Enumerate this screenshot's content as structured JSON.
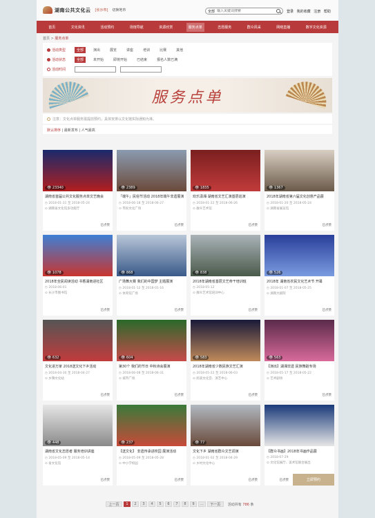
{
  "header": {
    "site_name": "湖南公共文化云",
    "region": "[长沙市]",
    "region_switch": "切换地市",
    "search_scope": "全部",
    "search_placeholder": "输入关键词搜索",
    "user_links": [
      "登录",
      "我的收藏",
      "注册",
      "帮助"
    ]
  },
  "nav": {
    "items": [
      "首页",
      "文化资讯",
      "活动预约",
      "场馆导航",
      "资源欣赏",
      "服务点单",
      "志愿服务",
      "群众风采",
      "网络直播",
      "数字文化资源"
    ],
    "active_index": 5
  },
  "breadcrumb": {
    "home": "首页",
    "sep": ">",
    "current": "服务点单"
  },
  "filters": {
    "type": {
      "label": "活动类型",
      "options": [
        "全部",
        "演出",
        "展览",
        "讲座",
        "培训",
        "比赛",
        "其他"
      ],
      "active_index": 0
    },
    "status": {
      "label": "活动状态",
      "options": [
        "全部",
        "未开始",
        "即将开始",
        "已结束",
        "报名人数已满"
      ],
      "active_index": 0
    },
    "time": {
      "label": "活动时间"
    }
  },
  "banner": {
    "title": "服务点单"
  },
  "notice": {
    "text": "注意：文化点单服务需提前预约，具体安排以文化馆实际通知为准。"
  },
  "sort": {
    "items": [
      "默认排序",
      "最新发布",
      "人气最高"
    ],
    "active_index": 0
  },
  "cards": [
    {
      "views": "23340",
      "title": "湖南省首届公共文化服务点单文艺晚会",
      "date": "2018-01-31 至 2018-05-24",
      "place": "湖南省文化馆多功能厅",
      "comment": "已点赞"
    },
    {
      "views": "2389",
      "title": "「端午」民俗节活动 2018年端午非遗展演",
      "date": "2018-06-18 至 2018-06-27",
      "place": "市民文化广场",
      "comment": "已点赞"
    },
    {
      "views": "1835",
      "title": "欢乐潇湘·湖南省文艺汇演基层巡演",
      "date": "2018-01-22 至 2018-06-26",
      "place": "群众艺术馆",
      "comment": "已点赞"
    },
    {
      "views": "1367",
      "title": "2018年湖南省第六届文化创意产品展",
      "date": "2018-01-20 至 2018-05-24",
      "place": "湖南省展览馆",
      "comment": "已点赞"
    },
    {
      "views": "1078",
      "title": "2018年全民阅读活动 书香湖南进社区",
      "date": "2018-06-01",
      "place": "长沙市图书馆",
      "comment": "已点赞"
    },
    {
      "views": "868",
      "title": "广场舞大赛 我们的中国梦 主题展演",
      "date": "2018-01-12 至 2018-01-16",
      "place": "体育馆广场",
      "comment": "已点赞"
    },
    {
      "views": "838",
      "title": "2018年湖南省基层文艺骨干培训班",
      "date": "2018-05-12",
      "place": "群众艺术馆培训中心",
      "comment": "已点赞"
    },
    {
      "views": "526",
      "title": "2018年 湖南省农民文化艺术节 开幕",
      "date": "2018-01-07 至 2018-05-25",
      "place": "湖南大剧院",
      "comment": "已点赞"
    },
    {
      "views": "632",
      "title": "文化进万家 2018送文化下乡活动",
      "date": "2018-04-30 至 2018-04-27",
      "place": "乡镇文化站",
      "comment": "已点赞"
    },
    {
      "views": "604",
      "title": "第30个 我们的节日 中秋诗会展演",
      "date": "2018-06-08 至 2018-06-31",
      "place": "城市广场",
      "comment": "已点赞"
    },
    {
      "views": "583",
      "title": "2018年湖南省少数民族文艺汇演",
      "date": "2018-05-22 至 2018-06-03",
      "place": "民族文化宫、演艺中心",
      "comment": "已点赞"
    },
    {
      "views": "563",
      "title": "【演出】湖湘非遗 民族舞蹈专场",
      "date": "2018-05-17 至 2018-05-22",
      "place": "艺术剧场",
      "comment": "已点赞"
    },
    {
      "views": "448",
      "title": "湖南省文化志愿者 服务培训讲座",
      "date": "2018-05-09 至 2018-05-14",
      "place": "省文化馆",
      "comment": "已点赞"
    },
    {
      "views": "237",
      "title": "【送文化】 非遗传承进校园 展演活动",
      "date": "2018-05-09 至 2018-05-28",
      "place": "中小学校园",
      "comment": "已点赞"
    },
    {
      "views": "77",
      "title": "文化下乡 湖南省群众文艺调演",
      "date": "2018-01-02 至 2018-04-29",
      "place": "乡村文化中心",
      "comment": "已点赞"
    },
    {
      "views": "",
      "title": "【群众书画】2018年书画作品展",
      "date": "2018-07-29",
      "place": "文化馆展厅、美术馆联合展出",
      "comment": "已点赞",
      "highlight": "立即预约"
    }
  ],
  "pager": {
    "prev": "上一页",
    "pages": [
      "1",
      "2",
      "3",
      "4",
      "5",
      "6",
      "7",
      "8",
      "9",
      "..."
    ],
    "current": "1",
    "next": "下一页",
    "total_prefix": "活动共有",
    "total_count": "786",
    "total_suffix": "条"
  },
  "colors": {
    "brand": "#b83a3a",
    "accent": "#c8b28e"
  }
}
